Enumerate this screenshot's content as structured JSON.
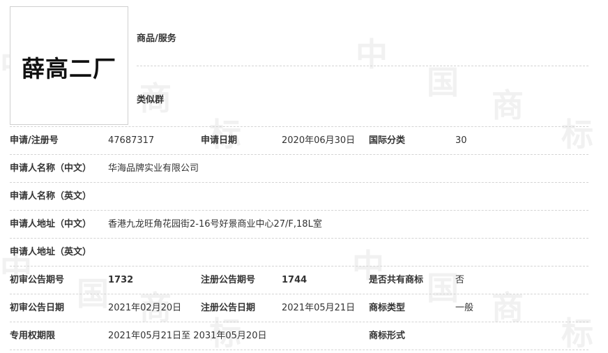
{
  "watermark": [
    "中",
    "国",
    "商",
    "标"
  ],
  "logo_text": "薛高二厂",
  "goods_services_label": "商品/服务",
  "similar_group_label": "类似群",
  "rows": [
    {
      "l1": "申请/注册号",
      "v1": "47687317",
      "l2": "申请日期",
      "v2": "2020年06月30日",
      "l3": "国际分类",
      "v3": "30"
    },
    {
      "l1": "申请人名称（中文）",
      "v1": "华海品牌实业有限公司"
    },
    {
      "l1": "申请人名称（英文）",
      "v1": ""
    },
    {
      "l1": "申请人地址（中文）",
      "v1": "香港九龙旺角花园街2-16号好景商业中心27/F,18L室"
    },
    {
      "l1": "申请人地址（英文）",
      "v1": ""
    },
    {
      "l1": "初审公告期号",
      "v1": "1732",
      "l2": "注册公告期号",
      "v2": "1744",
      "l3": "是否共有商标",
      "v3": "否"
    },
    {
      "l1": "初审公告日期",
      "v1": "2021年02月20日",
      "l2": "注册公告日期",
      "v2": "2021年05月21日",
      "l3": "商标类型",
      "v3": "一般"
    },
    {
      "l1": "专用权期限",
      "v1": "2021年05月21日至 2031年05月20日",
      "l2": "",
      "v2": "",
      "l3": "商标形式",
      "v3": ""
    }
  ]
}
